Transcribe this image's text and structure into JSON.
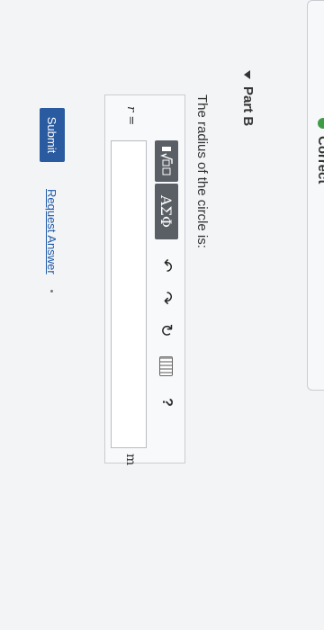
{
  "status": {
    "label": "Correct",
    "color": "#3f9c46"
  },
  "part": {
    "title": "Part B",
    "question": "The radius of the circle is:"
  },
  "toolbar": {
    "greek_label": "ΑΣΦ",
    "templates_icon": "templates-icon",
    "undo_icon": "undo-icon",
    "redo_icon": "redo-icon",
    "reset_icon": "reset-icon",
    "keyboard_icon": "keyboard-icon",
    "help_label": "?"
  },
  "answer": {
    "variable_label": "r =",
    "value": "",
    "unit": "m"
  },
  "actions": {
    "submit_label": "Submit",
    "request_label": "Request Answer",
    "submit_color": "#2a5aa0"
  }
}
